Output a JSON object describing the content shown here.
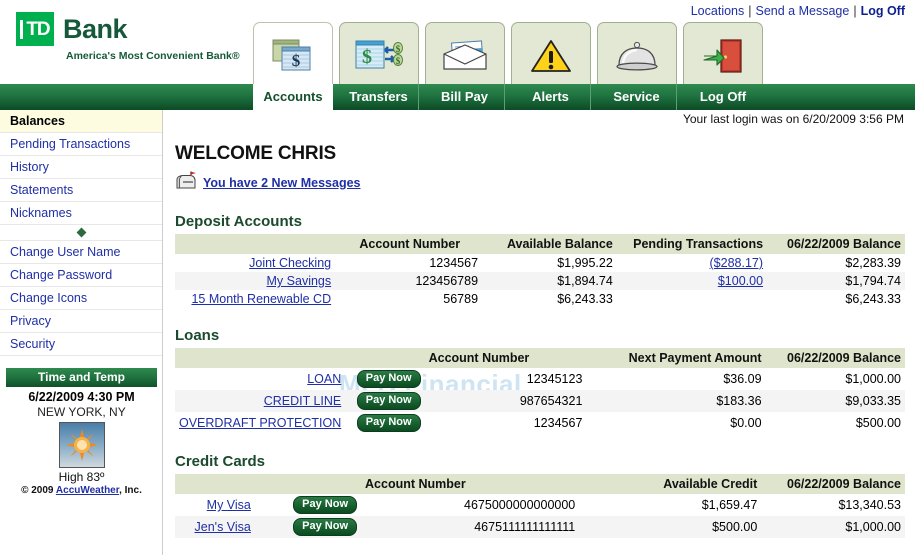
{
  "brand": {
    "mark_text": "TD",
    "name": "Bank",
    "tagline": "America's Most Convenient Bank®",
    "logo_green": "#00b04f",
    "dark_green": "#16593a"
  },
  "top_links": {
    "locations": "Locations",
    "send_message": "Send a Message",
    "log_off": "Log Off",
    "separator": "|"
  },
  "tabs": [
    {
      "label": "Accounts",
      "icon": "accounts-windows-dollar-icon",
      "active": true
    },
    {
      "label": "Transfers",
      "icon": "transfers-money-arrows-icon",
      "active": false
    },
    {
      "label": "Bill Pay",
      "icon": "billpay-envelope-check-icon",
      "active": false
    },
    {
      "label": "Alerts",
      "icon": "alerts-warning-triangle-icon",
      "active": false
    },
    {
      "label": "Service",
      "icon": "service-bell-icon",
      "active": false
    },
    {
      "label": "Log Off",
      "icon": "logoff-door-arrow-icon",
      "active": false
    }
  ],
  "sidebar": {
    "items": [
      {
        "label": "Balances",
        "current": true
      },
      {
        "label": "Pending Transactions",
        "current": false
      },
      {
        "label": "History",
        "current": false
      },
      {
        "label": "Statements",
        "current": false
      },
      {
        "label": "Nicknames",
        "current": false
      }
    ],
    "items2": [
      {
        "label": "Change User Name"
      },
      {
        "label": "Change Password"
      },
      {
        "label": "Change Icons"
      },
      {
        "label": "Privacy"
      },
      {
        "label": "Security"
      }
    ],
    "weather": {
      "header": "Time and Temp",
      "datetime": "6/22/2009 4:30 PM",
      "city": "NEW YORK, NY",
      "icon": "sunny-weather-icon",
      "high": "High 83º",
      "credit_prefix": "© 2009 ",
      "credit_link": "AccuWeather",
      "credit_suffix": ", Inc."
    }
  },
  "main": {
    "last_login": "Your last login was on 6/20/2009 3:56 PM",
    "welcome": "WELCOME CHRIS",
    "messages_icon": "mailbox-icon",
    "messages_link": "You have 2 New Messages",
    "watermark": "MFB Financial",
    "sections": [
      {
        "title": "Deposit Accounts",
        "columns": [
          "",
          "",
          "Account Number",
          "Available Balance",
          "Pending Transactions",
          "06/22/2009 Balance"
        ],
        "rows": [
          {
            "name": "Joint Checking",
            "pay": "",
            "number": "1234567",
            "c1": "$1,995.22",
            "c2": "($288.17)",
            "c2_link": true,
            "c3": "$2,283.39"
          },
          {
            "name": "My Savings",
            "pay": "",
            "number": "123456789",
            "c1": "$1,894.74",
            "c2": "$100.00",
            "c2_link": true,
            "c3": "$1,794.74"
          },
          {
            "name": "15 Month Renewable CD",
            "pay": "",
            "number": "56789",
            "c1": "$6,243.33",
            "c2": "",
            "c2_link": false,
            "c3": "$6,243.33"
          }
        ]
      },
      {
        "title": "Loans",
        "columns": [
          "",
          "",
          "Account Number",
          "Next Payment Amount",
          "06/22/2009 Balance"
        ],
        "rows": [
          {
            "name": "LOAN",
            "pay": "Pay Now",
            "number": "12345123",
            "c1": "$36.09",
            "c3": "$1,000.00"
          },
          {
            "name": "CREDIT LINE",
            "pay": "Pay Now",
            "number": "987654321",
            "c1": "$183.36",
            "c3": "$9,033.35"
          },
          {
            "name": "OVERDRAFT PROTECTION",
            "pay": "Pay Now",
            "number": "1234567",
            "c1": "$0.00",
            "c3": "$500.00"
          }
        ]
      },
      {
        "title": "Credit Cards",
        "columns": [
          "",
          "",
          "Account Number",
          "Available Credit",
          "06/22/2009 Balance"
        ],
        "rows": [
          {
            "name": "My Visa",
            "pay": "Pay Now",
            "number": "4675000000000000",
            "c1": "$1,659.47",
            "c3": "$13,340.53"
          },
          {
            "name": "Jen's Visa",
            "pay": "Pay Now",
            "number": "4675111111111111",
            "c1": "$500.00",
            "c3": "$1,000.00"
          }
        ]
      }
    ]
  }
}
